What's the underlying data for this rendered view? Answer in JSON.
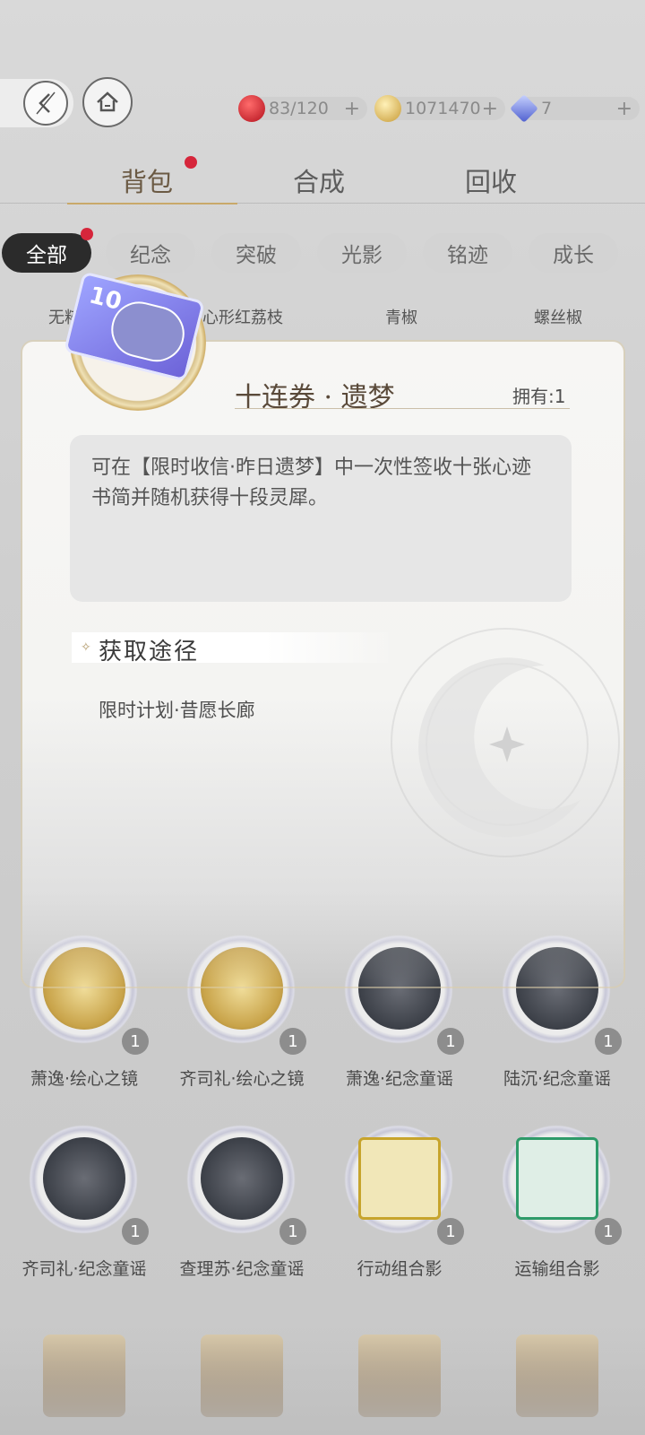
{
  "topbar": {
    "resources": [
      {
        "icon": "apple-icon",
        "value": "83/120",
        "color": "#c8232c"
      },
      {
        "icon": "coin-icon",
        "value": "1071470",
        "color": "#d9b25a"
      },
      {
        "icon": "crystal-icon",
        "value": "7",
        "color": "#5b6bd6"
      }
    ],
    "plus": "+"
  },
  "tabs": {
    "bag": "背包",
    "synthesis": "合成",
    "recycle": "回收"
  },
  "filters": [
    "全部",
    "纪念",
    "突破",
    "光影",
    "铭迹",
    "成长"
  ],
  "peek_labels": [
    "无粹",
    "心形红荔枝",
    "青椒",
    "螺丝椒"
  ],
  "item_detail": {
    "ticket_number": "10",
    "title": "十连券 · 遗梦",
    "owned": "拥有:1",
    "description": "可在【限时收信·昨日遗梦】中一次性签收十张心迹书简并随机获得十段灵犀。",
    "source_heading": "获取途径",
    "source_item": "限时计划·昔愿长廊"
  },
  "grid": [
    {
      "label": "萧逸·绘心之镜",
      "count": "1",
      "kind": "gold"
    },
    {
      "label": "齐司礼·绘心之镜",
      "count": "1",
      "kind": "gold"
    },
    {
      "label": "萧逸·纪念童谣",
      "count": "1",
      "kind": "dark"
    },
    {
      "label": "陆沉·纪念童谣",
      "count": "1",
      "kind": "dark"
    },
    {
      "label": "齐司礼·纪念童谣",
      "count": "1",
      "kind": "dark"
    },
    {
      "label": "查理苏·纪念童谣",
      "count": "1",
      "kind": "dark"
    },
    {
      "label": "行动组合影",
      "count": "1",
      "kind": "yellow"
    },
    {
      "label": "运输组合影",
      "count": "1",
      "kind": "green"
    }
  ]
}
